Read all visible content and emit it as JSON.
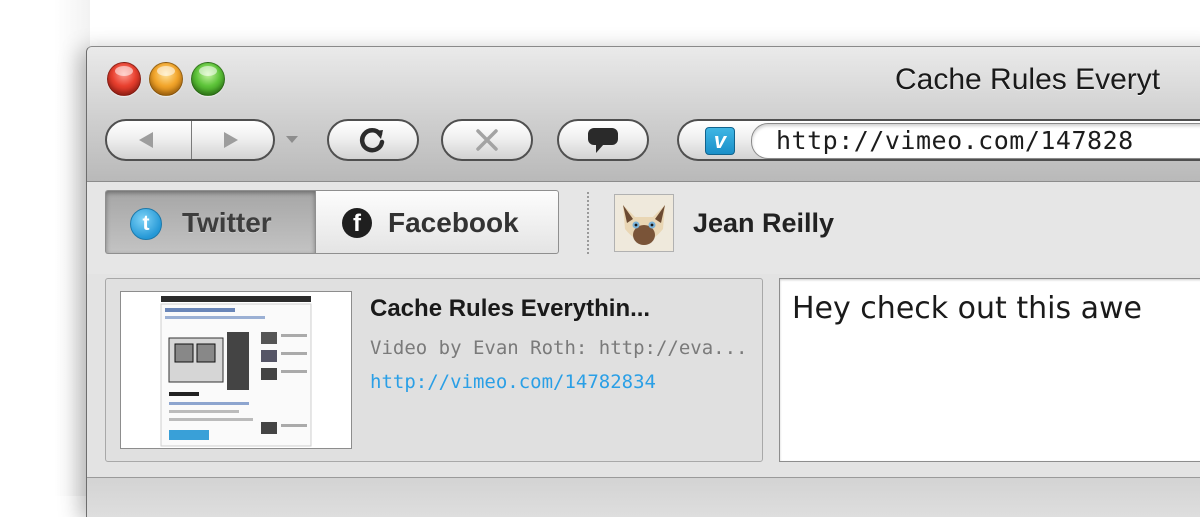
{
  "window": {
    "title": "Cache Rules Everyt"
  },
  "toolbar": {
    "back_icon": "back-arrow-icon",
    "forward_icon": "forward-arrow-icon",
    "reload_icon": "reload-icon",
    "stop_icon": "stop-x-icon",
    "chat_icon": "speech-bubble-icon",
    "site_badge": "v",
    "url": "http://vimeo.com/147828"
  },
  "share": {
    "tabs": [
      {
        "label": "Twitter",
        "icon": "twitter-icon",
        "icon_glyph": "t",
        "selected": true
      },
      {
        "label": "Facebook",
        "icon": "facebook-icon",
        "icon_glyph": "f",
        "selected": false
      }
    ],
    "user_name": "Jean Reilly"
  },
  "link_card": {
    "title": "Cache Rules Everythin...",
    "description": "Video by Evan Roth: http://eva...",
    "url": "http://vimeo.com/14782834"
  },
  "compose": {
    "text": "Hey check out this awe"
  },
  "colors": {
    "link_blue": "#2a9fe6",
    "twitter_blue": "#2598d6",
    "vimeo_blue": "#1a8fc8"
  }
}
